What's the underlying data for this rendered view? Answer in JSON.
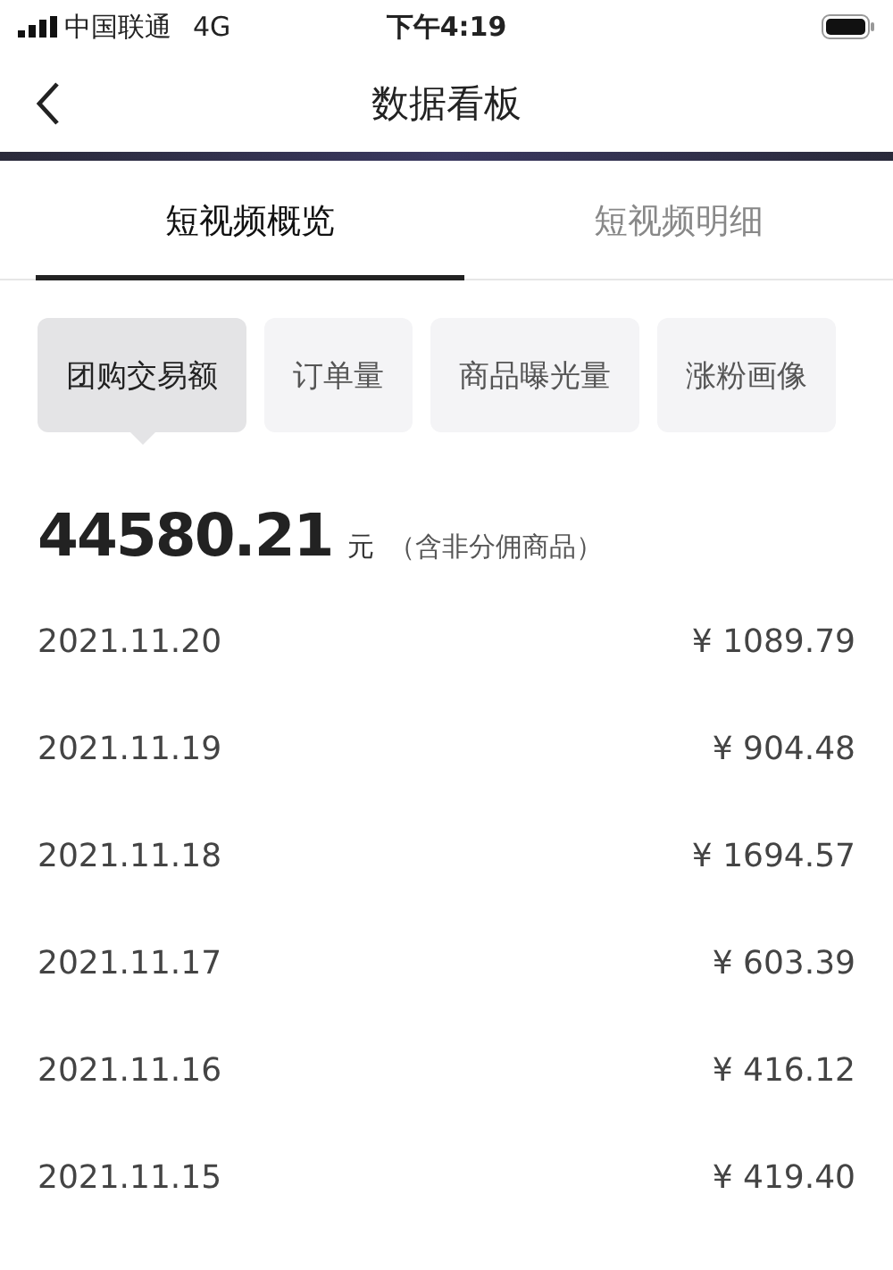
{
  "status_bar": {
    "carrier": "中国联通",
    "network": "4G",
    "time": "下午4:19"
  },
  "header": {
    "title": "数据看板"
  },
  "tabs": [
    {
      "label": "短视频概览",
      "selected": true
    },
    {
      "label": "短视频明细",
      "selected": false
    }
  ],
  "metrics": [
    {
      "label": "团购交易额",
      "selected": true
    },
    {
      "label": "订单量",
      "selected": false
    },
    {
      "label": "商品曝光量",
      "selected": false
    },
    {
      "label": "涨粉画像",
      "selected": false
    }
  ],
  "total": {
    "value": "44580.21",
    "unit": "元",
    "note": "（含非分佣商品）"
  },
  "rows": [
    {
      "date": "2021.11.20",
      "amount": "¥ 1089.79"
    },
    {
      "date": "2021.11.19",
      "amount": "¥ 904.48"
    },
    {
      "date": "2021.11.18",
      "amount": "¥ 1694.57"
    },
    {
      "date": "2021.11.17",
      "amount": "¥ 603.39"
    },
    {
      "date": "2021.11.16",
      "amount": "¥ 416.12"
    },
    {
      "date": "2021.11.15",
      "amount": "¥ 419.40"
    }
  ]
}
